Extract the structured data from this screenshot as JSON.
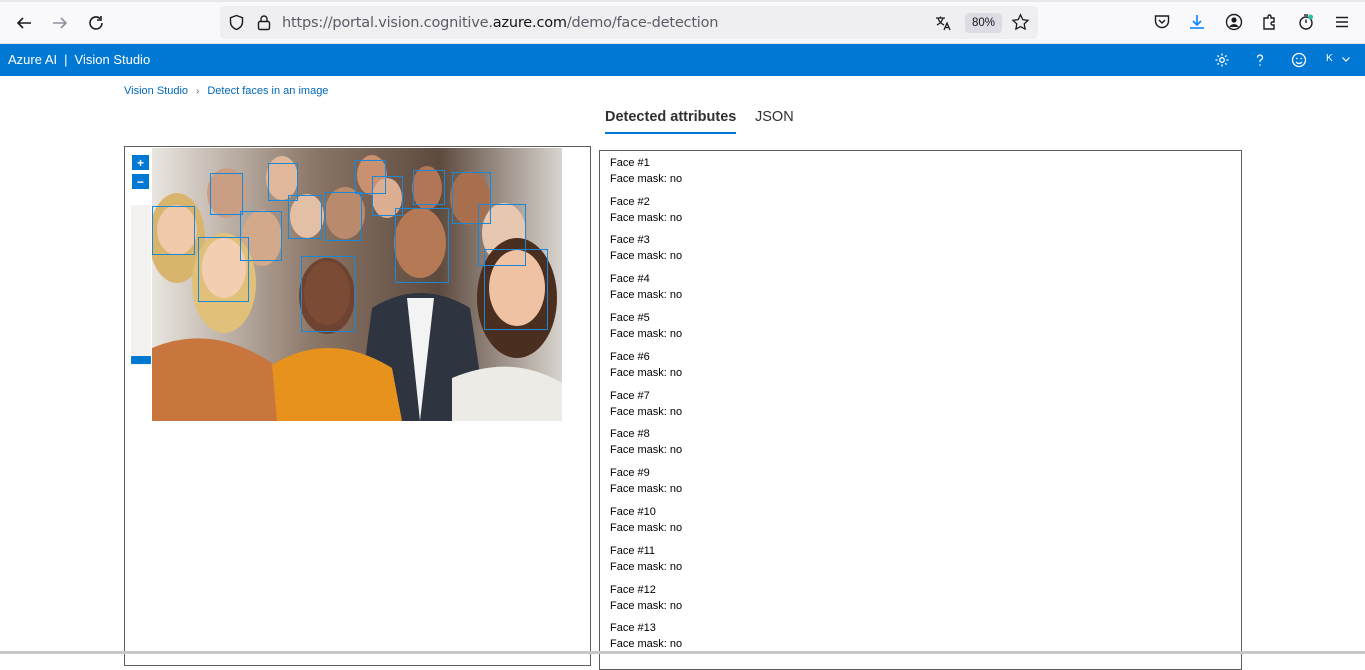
{
  "browser": {
    "url_prefix": "https://portal.vision.cognitive.",
    "url_host": "azure.com",
    "url_path": "/demo/face-detection",
    "zoom": "80%"
  },
  "header": {
    "brand_left": "Azure AI",
    "brand_sep": "|",
    "brand_right": "Vision Studio",
    "user_initial": "K"
  },
  "breadcrumb": {
    "root": "Vision Studio",
    "current": "Detect faces in an image"
  },
  "tabs": [
    {
      "label": "Detected attributes",
      "active": true
    },
    {
      "label": "JSON",
      "active": false
    }
  ],
  "zoom_controls": {
    "plus": "+",
    "minus": "−",
    "level": 0.0
  },
  "faces": [
    {
      "title": "Face #1",
      "mask": "Face mask: no"
    },
    {
      "title": "Face #2",
      "mask": "Face mask: no"
    },
    {
      "title": "Face #3",
      "mask": "Face mask: no"
    },
    {
      "title": "Face #4",
      "mask": "Face mask: no"
    },
    {
      "title": "Face #5",
      "mask": "Face mask: no"
    },
    {
      "title": "Face #6",
      "mask": "Face mask: no"
    },
    {
      "title": "Face #7",
      "mask": "Face mask: no"
    },
    {
      "title": "Face #8",
      "mask": "Face mask: no"
    },
    {
      "title": "Face #9",
      "mask": "Face mask: no"
    },
    {
      "title": "Face #10",
      "mask": "Face mask: no"
    },
    {
      "title": "Face #11",
      "mask": "Face mask: no"
    },
    {
      "title": "Face #12",
      "mask": "Face mask: no"
    },
    {
      "title": "Face #13",
      "mask": "Face mask: no"
    }
  ],
  "colors": {
    "azure_blue": "#0078d4",
    "face_box": "#1b87d6"
  }
}
